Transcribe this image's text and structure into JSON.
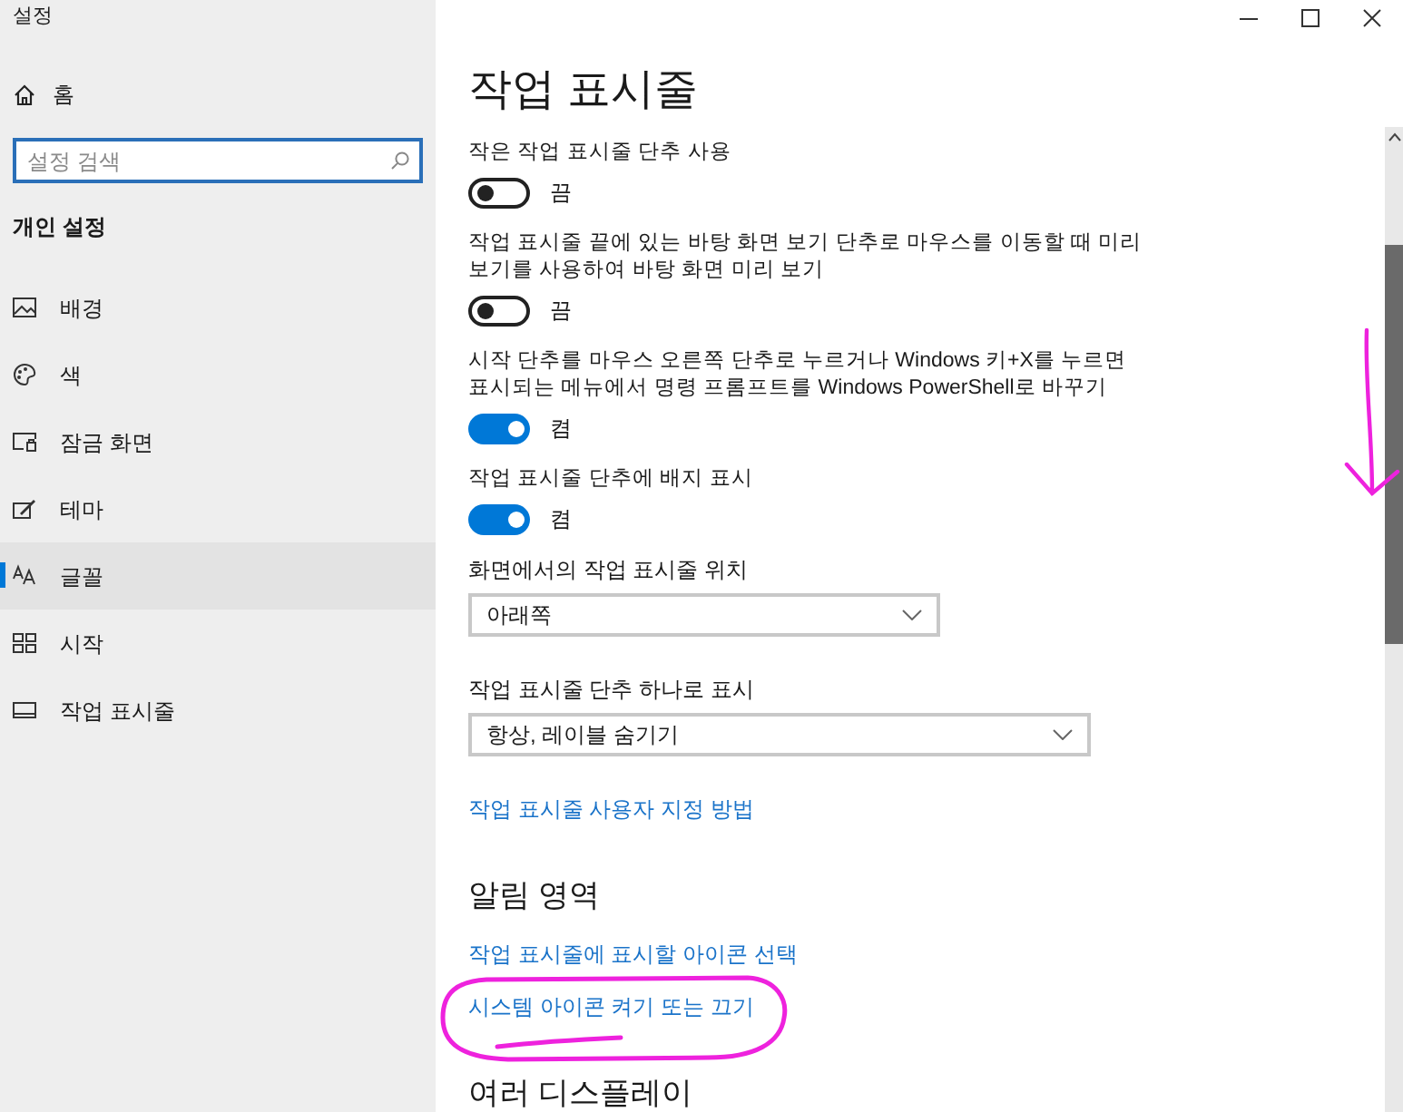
{
  "window": {
    "title": "설정"
  },
  "sidebar": {
    "home": "홈",
    "search": {
      "placeholder": "설정 검색"
    },
    "group_heading": "개인 설정",
    "items": [
      {
        "label": "배경",
        "selected": false
      },
      {
        "label": "색",
        "selected": false
      },
      {
        "label": "잠금 화면",
        "selected": false
      },
      {
        "label": "테마",
        "selected": false
      },
      {
        "label": "글꼴",
        "selected": true
      },
      {
        "label": "시작",
        "selected": false
      },
      {
        "label": "작업 표시줄",
        "selected": false
      }
    ]
  },
  "main": {
    "sections": [
      {
        "heading": "작업 표시줄",
        "kind": "title",
        "items": [
          {
            "kind": "toggle",
            "label": "작은 작업 표시줄 단추 사용",
            "on": false,
            "state_text": "끔"
          },
          {
            "kind": "toggle",
            "label": "작업 표시줄 끝에 있는 바탕 화면 보기 단추로 마우스를 이동할 때 미리 보기를 사용하여 바탕 화면 미리 보기",
            "on": false,
            "state_text": "끔"
          },
          {
            "kind": "toggle",
            "label": "시작 단추를 마우스 오른쪽 단추로 누르거나 Windows 키+X를 누르면 표시되는 메뉴에서 명령 프롬프트를 Windows PowerShell로 바꾸기",
            "on": true,
            "state_text": "켬"
          },
          {
            "kind": "toggle",
            "label": "작업 표시줄 단추에 배지 표시",
            "on": true,
            "state_text": "켬"
          },
          {
            "kind": "dropdown",
            "label": "화면에서의 작업 표시줄 위치",
            "value": "아래쪽",
            "wide": false
          },
          {
            "kind": "dropdown",
            "label": "작업 표시줄 단추 하나로 표시",
            "value": "항상, 레이블 숨기기",
            "wide": true
          },
          {
            "kind": "link",
            "label": "작업 표시줄 사용자 지정 방법"
          }
        ]
      },
      {
        "heading": "알림 영역",
        "kind": "section",
        "items": [
          {
            "kind": "link",
            "label": "작업 표시줄에 표시할 아이콘 선택"
          },
          {
            "kind": "link",
            "label": "시스템 아이콘 켜기 또는 끄기"
          }
        ]
      },
      {
        "heading": "여러 디스플레이",
        "kind": "section"
      }
    ]
  }
}
